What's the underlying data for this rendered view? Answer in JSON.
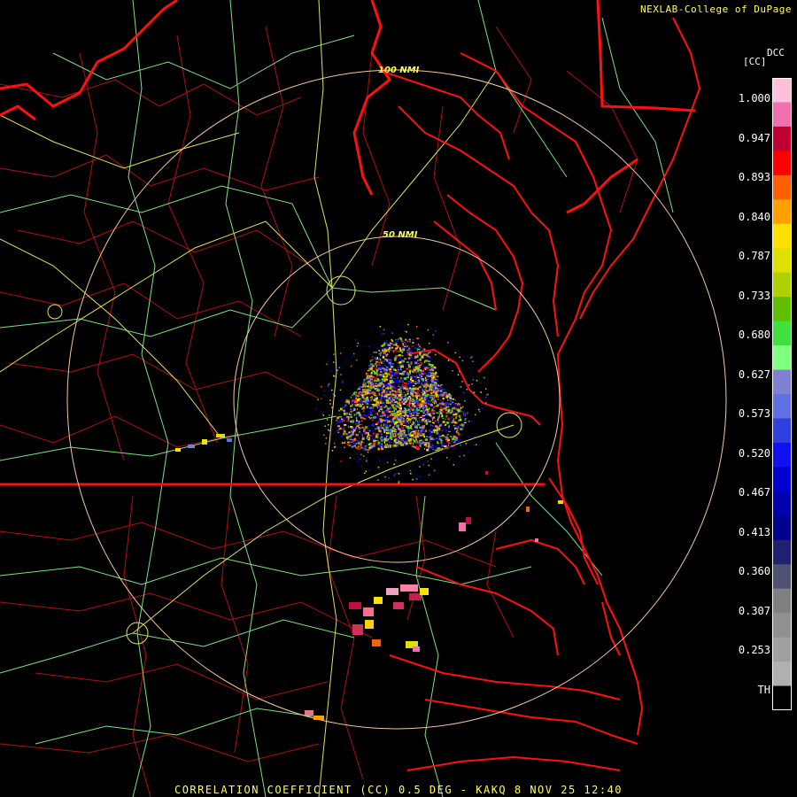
{
  "credit": "NEXLAB-College of DuPage",
  "legend": {
    "product_code": "DCC",
    "unit": "[CC]",
    "ticks": [
      "1.000",
      "0.947",
      "0.893",
      "0.840",
      "0.787",
      "0.733",
      "0.680",
      "0.627",
      "0.573",
      "0.520",
      "0.467",
      "0.413",
      "0.360",
      "0.307",
      "0.253",
      "TH"
    ],
    "colors": [
      "#ffc0dc",
      "#f070b0",
      "#c00030",
      "#ff0000",
      "#ff6000",
      "#ffa000",
      "#ffe000",
      "#e0e000",
      "#b0d000",
      "#60c000",
      "#40e040",
      "#80ff80",
      "#8080d0",
      "#6070e0",
      "#3040e0",
      "#1010f0",
      "#0000d0",
      "#0000b0",
      "#000090",
      "#202070",
      "#505070",
      "#808080",
      "#909090",
      "#a0a0a0",
      "#b0b0b0",
      "#000000"
    ]
  },
  "range_rings": {
    "inner_label": "50 NMI",
    "outer_label": "100 NMI"
  },
  "caption": "CORRELATION COEFFICIENT (CC) 0.5 DEG - KAKQ 8 NOV 25 12:40"
}
